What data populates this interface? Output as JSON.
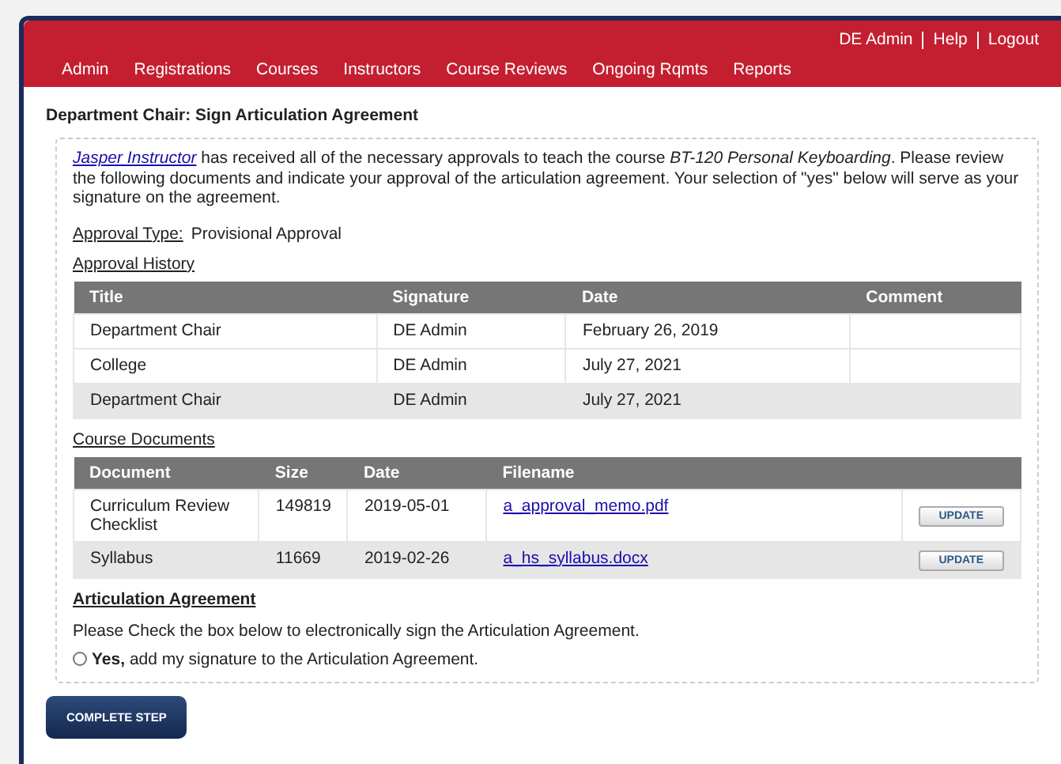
{
  "user_links": [
    "DE Admin",
    "Help",
    "Logout"
  ],
  "nav": [
    "Admin",
    "Registrations",
    "Courses",
    "Instructors",
    "Course Reviews",
    "Ongoing Rqmts",
    "Reports"
  ],
  "page_title": "Department Chair: Sign Articulation Agreement",
  "intro": {
    "link": "Jasper Instructor",
    "text": " has received all of the necessary approvals to teach the course *BT-120 Personal Keyboarding*. Please review the following documents and indicate your approval of the articulation agreement. Your selection of \"yes\" below will serve as your signature on the agreement."
  },
  "approval_type": {
    "label": "Approval Type:",
    "value": "Provisional Approval"
  },
  "approval_history": {
    "heading": "Approval History",
    "columns": [
      "Title",
      "Signature",
      "Date",
      "Comment"
    ],
    "rows": [
      {
        "cells": [
          "Department Chair",
          "DE Admin",
          "February 26, 2019",
          ""
        ],
        "shaded": false
      },
      {
        "cells": [
          "College",
          "DE Admin",
          "July 27, 2021",
          ""
        ],
        "shaded": false
      },
      {
        "cells": [
          "Department Chair",
          "DE Admin",
          "July 27, 2021",
          ""
        ],
        "shaded": true
      }
    ]
  },
  "course_documents": {
    "heading": "Course Documents",
    "columns": [
      "Document",
      "Size",
      "Date",
      "Filename"
    ],
    "rows": [
      {
        "document": "Curriculum Review Checklist",
        "size": "149819",
        "date": "2019-05-01",
        "filename": "a_approval_memo.pdf",
        "button": "UPDATE",
        "shaded": false
      },
      {
        "document": "Syllabus",
        "size": "11669",
        "date": "2019-02-26",
        "filename": "a_hs_syllabus.docx",
        "button": "UPDATE",
        "shaded": true
      }
    ]
  },
  "articulation": {
    "heading": "Articulation Agreement",
    "instruction": "Please Check the box below to electronically sign the Articulation Agreement.",
    "option": "**Yes,** add my signature to the Articulation Agreement.",
    "selected": false
  },
  "complete_button": "COMPLETE STEP"
}
